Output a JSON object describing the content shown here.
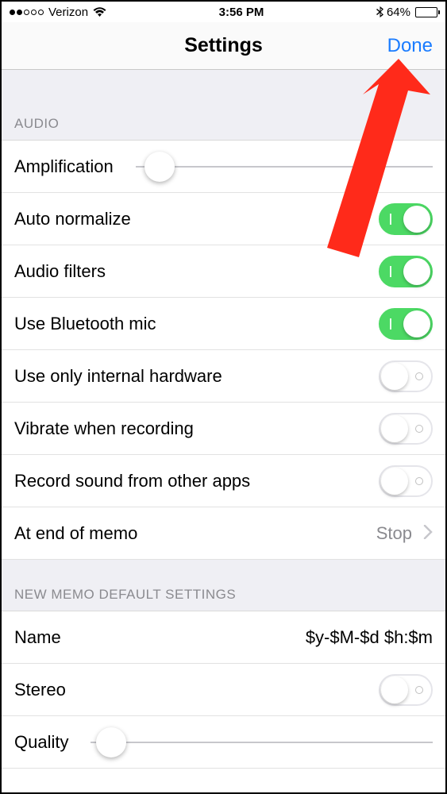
{
  "status": {
    "carrier": "Verizon",
    "time": "3:56 PM",
    "battery_pct": "64%",
    "signal_filled": 2,
    "signal_total": 5
  },
  "nav": {
    "title": "Settings",
    "done": "Done"
  },
  "sections": {
    "audio_header": "AUDIO",
    "memo_header": "NEW MEMO DEFAULT SETTINGS"
  },
  "audio": {
    "amplification": {
      "label": "Amplification",
      "value_pct": 8
    },
    "auto_normalize": {
      "label": "Auto normalize",
      "on": true
    },
    "audio_filters": {
      "label": "Audio filters",
      "on": true
    },
    "bluetooth_mic": {
      "label": "Use Bluetooth mic",
      "on": true
    },
    "internal_hw": {
      "label": "Use only internal hardware",
      "on": false
    },
    "vibrate": {
      "label": "Vibrate when recording",
      "on": false
    },
    "record_other": {
      "label": "Record sound from other apps",
      "on": false
    },
    "end_memo": {
      "label": "At end of memo",
      "value": "Stop"
    }
  },
  "memo": {
    "name": {
      "label": "Name",
      "value": "$y-$M-$d $h:$m"
    },
    "stereo": {
      "label": "Stereo",
      "on": false
    },
    "quality": {
      "label": "Quality",
      "value_pct": 6
    }
  },
  "arrow_color": "#ff2a1a"
}
